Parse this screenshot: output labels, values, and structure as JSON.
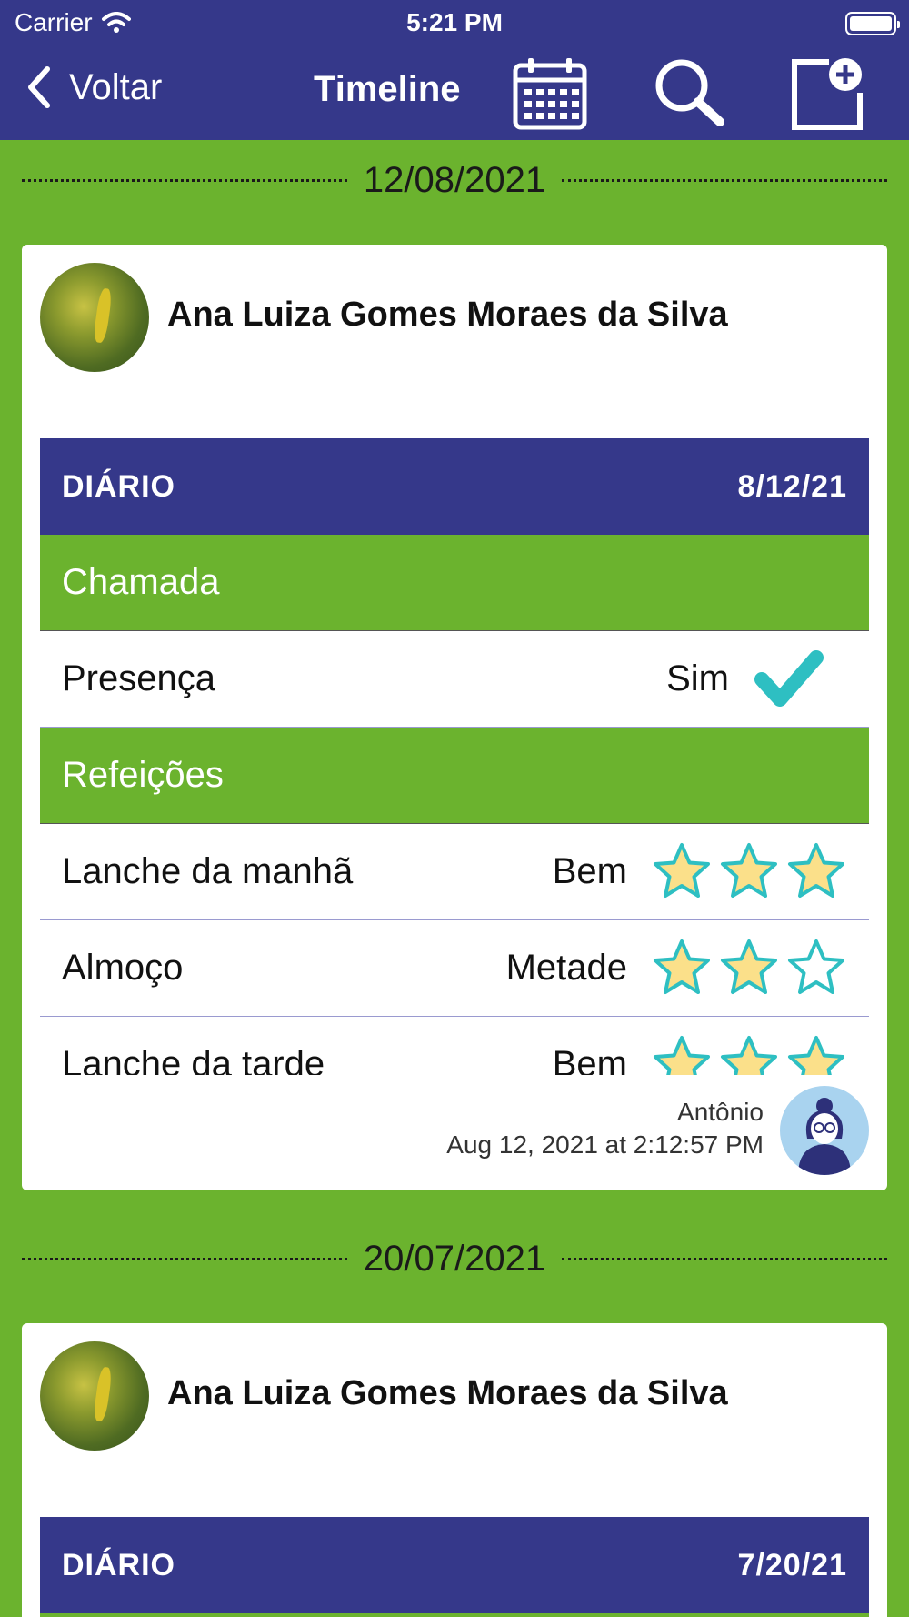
{
  "status_bar": {
    "carrier": "Carrier",
    "time": "5:21 PM"
  },
  "nav": {
    "back_label": "Voltar",
    "title": "Timeline"
  },
  "colors": {
    "header": "#35388a",
    "background": "#6bb32e",
    "accent": "#2ebfc2",
    "star_fill": "#fbe08a"
  },
  "icons": [
    "chevron-left-icon",
    "calendar-icon",
    "search-icon",
    "add-note-icon",
    "check-icon",
    "star-icon"
  ],
  "entries": [
    {
      "date": "12/08/2021",
      "student": "Ana Luiza Gomes Moraes da Silva",
      "diary_label": "DIÁRIO",
      "diary_date": "8/12/21",
      "sections": [
        {
          "title": "Chamada",
          "rows": [
            {
              "label": "Presença",
              "value": "Sim"
            }
          ]
        },
        {
          "title": "Refeições",
          "rows": [
            {
              "label": "Lanche da manhã",
              "value": "Bem",
              "stars_filled": 3,
              "stars_total": 3
            },
            {
              "label": "Almoço",
              "value": "Metade",
              "stars_filled": 2,
              "stars_total": 3
            },
            {
              "label": "Lanche da tarde",
              "value": "Bem",
              "stars_filled": 3,
              "stars_total": 3
            }
          ]
        }
      ],
      "author": "Antônio",
      "timestamp": "Aug 12, 2021 at 2:12:57 PM"
    },
    {
      "date": "20/07/2021",
      "student": "Ana Luiza Gomes Moraes da Silva",
      "diary_label": "DIÁRIO",
      "diary_date": "7/20/21"
    }
  ]
}
